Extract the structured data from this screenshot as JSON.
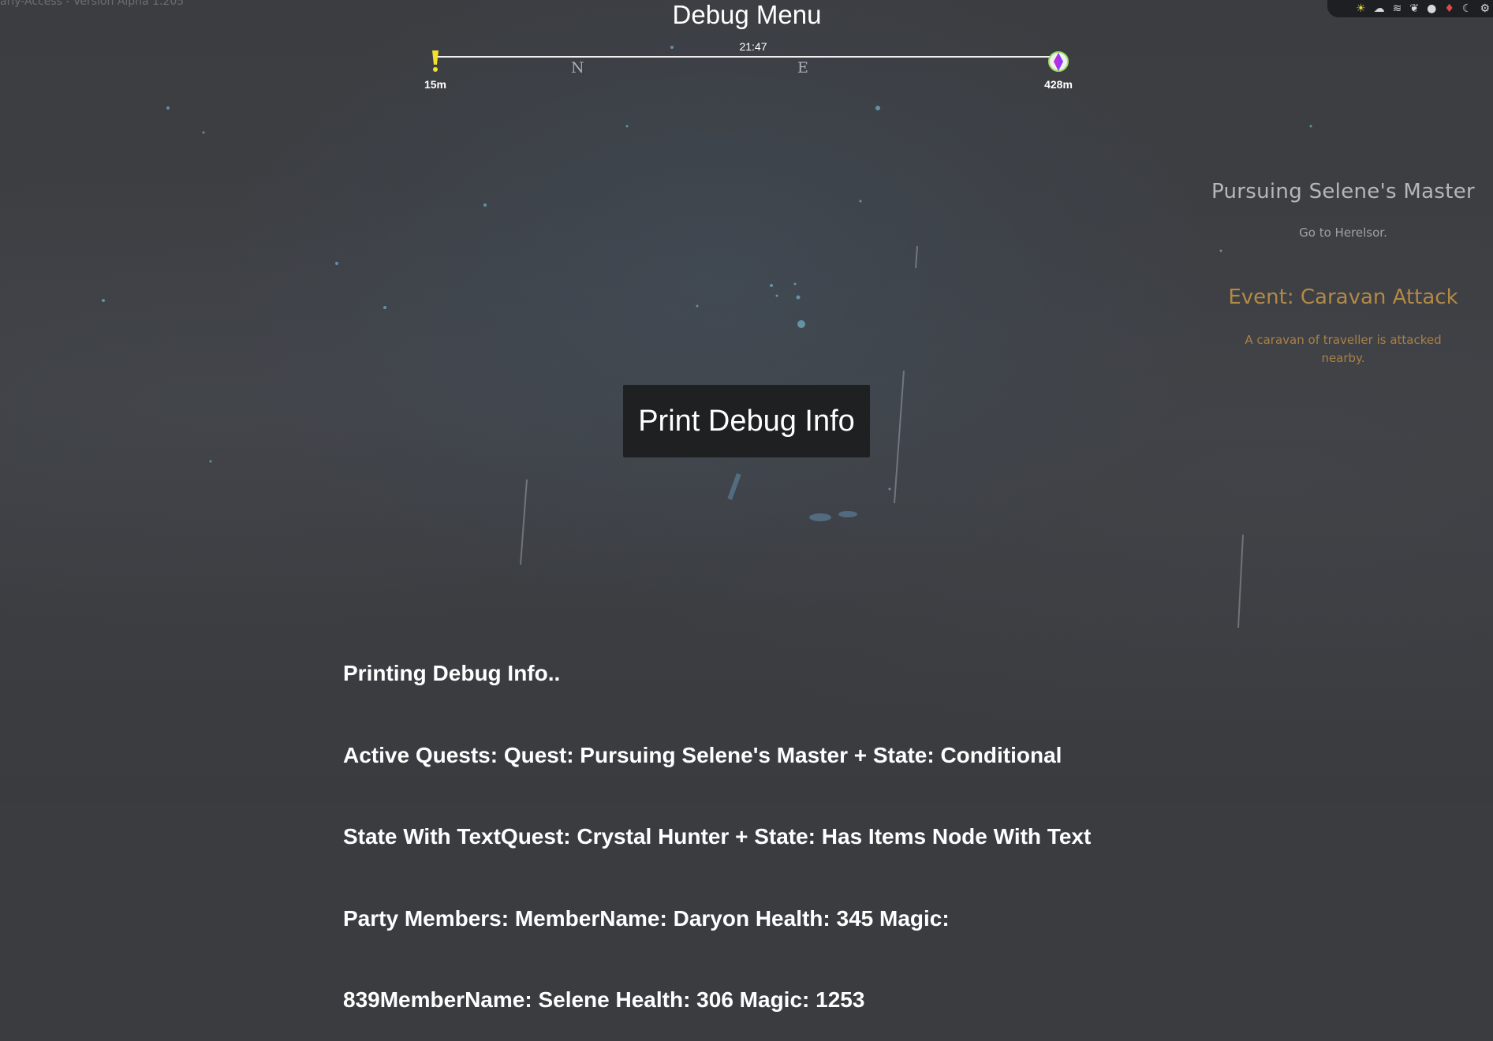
{
  "version_text": "arly-Access - Version Alpha 1.205",
  "menu": {
    "title": "Debug Menu"
  },
  "compass": {
    "time": "21:47",
    "directions": [
      "N",
      "E"
    ],
    "markers": [
      {
        "label": "15m",
        "icon": "exclamation-quest-icon",
        "color": "#f2e12a"
      },
      {
        "label": "428m",
        "icon": "crystal-waypoint-icon",
        "color": "#8a3cff"
      }
    ]
  },
  "hud": {
    "icons": [
      {
        "name": "sun-icon",
        "color": "#e8d83a"
      },
      {
        "name": "cloud-icon",
        "color": "#d8d8d8"
      },
      {
        "name": "wind-icon",
        "color": "#d8d8d8"
      },
      {
        "name": "leaf-icon",
        "color": "#d8d8d8"
      },
      {
        "name": "drop-icon",
        "color": "#d8d8d8"
      },
      {
        "name": "fire-icon",
        "color": "#e04848"
      },
      {
        "name": "moon-icon",
        "color": "#d8d8d8"
      },
      {
        "name": "settings-icon",
        "color": "#d8d8d8"
      }
    ]
  },
  "quest": {
    "title": "Pursuing Selene's Master",
    "description": "Go to Herelsor."
  },
  "event": {
    "title": "Event: Caravan Attack",
    "description": "A caravan of traveller is attacked nearby."
  },
  "button": {
    "label": "Print Debug Info"
  },
  "debug_output": {
    "lines": [
      "Printing Debug Info..",
      "Active Quests: Quest: Pursuing Selene's Master + State: Conditional",
      "State With TextQuest: Crystal Hunter + State: Has Items Node With Text",
      "Party Members: MemberName: Daryon Health: 345 Magic:",
      "839MemberName: Selene Health: 306 Magic: 1253"
    ]
  }
}
